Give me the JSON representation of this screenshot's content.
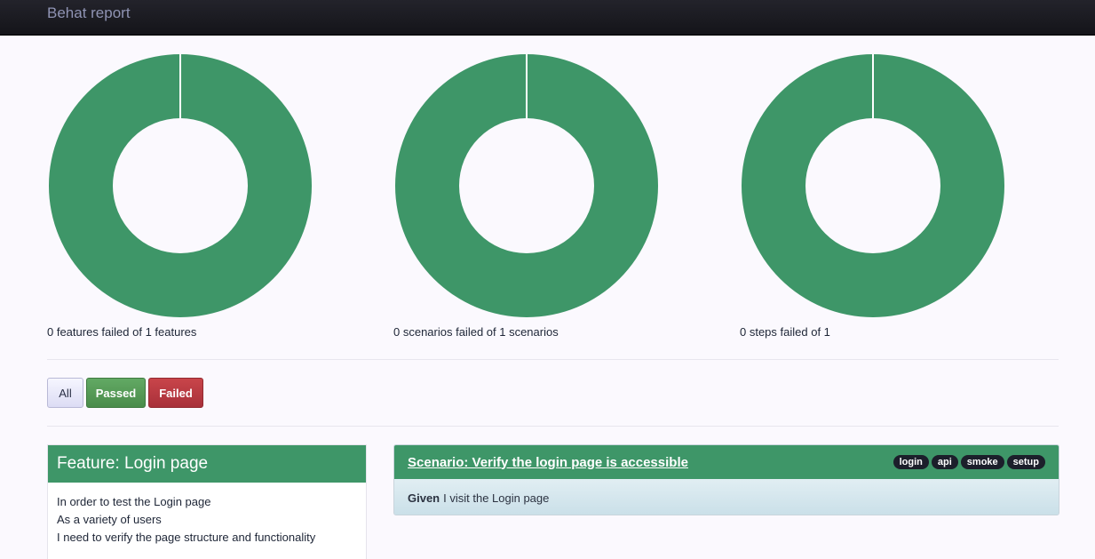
{
  "app": {
    "title": "Behat report"
  },
  "colors": {
    "passed": "#3e9668",
    "failed": "#a8303a",
    "navbar": "#1b1b22"
  },
  "chart_data": [
    {
      "type": "pie",
      "donut": true,
      "labels": [
        "passed",
        "failed"
      ],
      "values": [
        1,
        0
      ],
      "caption": "0 features failed of 1 features"
    },
    {
      "type": "pie",
      "donut": true,
      "labels": [
        "passed",
        "failed"
      ],
      "values": [
        1,
        0
      ],
      "caption": "0 scenarios failed of 1 scenarios"
    },
    {
      "type": "pie",
      "donut": true,
      "labels": [
        "passed",
        "failed"
      ],
      "values": [
        1,
        0
      ],
      "caption": "0 steps failed of 1"
    }
  ],
  "filters": {
    "all": "All",
    "passed": "Passed",
    "failed": "Failed"
  },
  "feature": {
    "title": "Feature: Login page",
    "description": [
      "In order to test the Login page",
      "As a variety of users",
      "I need to verify the page structure and functionality"
    ]
  },
  "scenario": {
    "title": "Scenario: Verify the login page is accessible",
    "tags": [
      "login",
      "api",
      "smoke",
      "setup"
    ],
    "steps": [
      {
        "keyword": "Given",
        "text": "I visit the Login page"
      }
    ]
  }
}
